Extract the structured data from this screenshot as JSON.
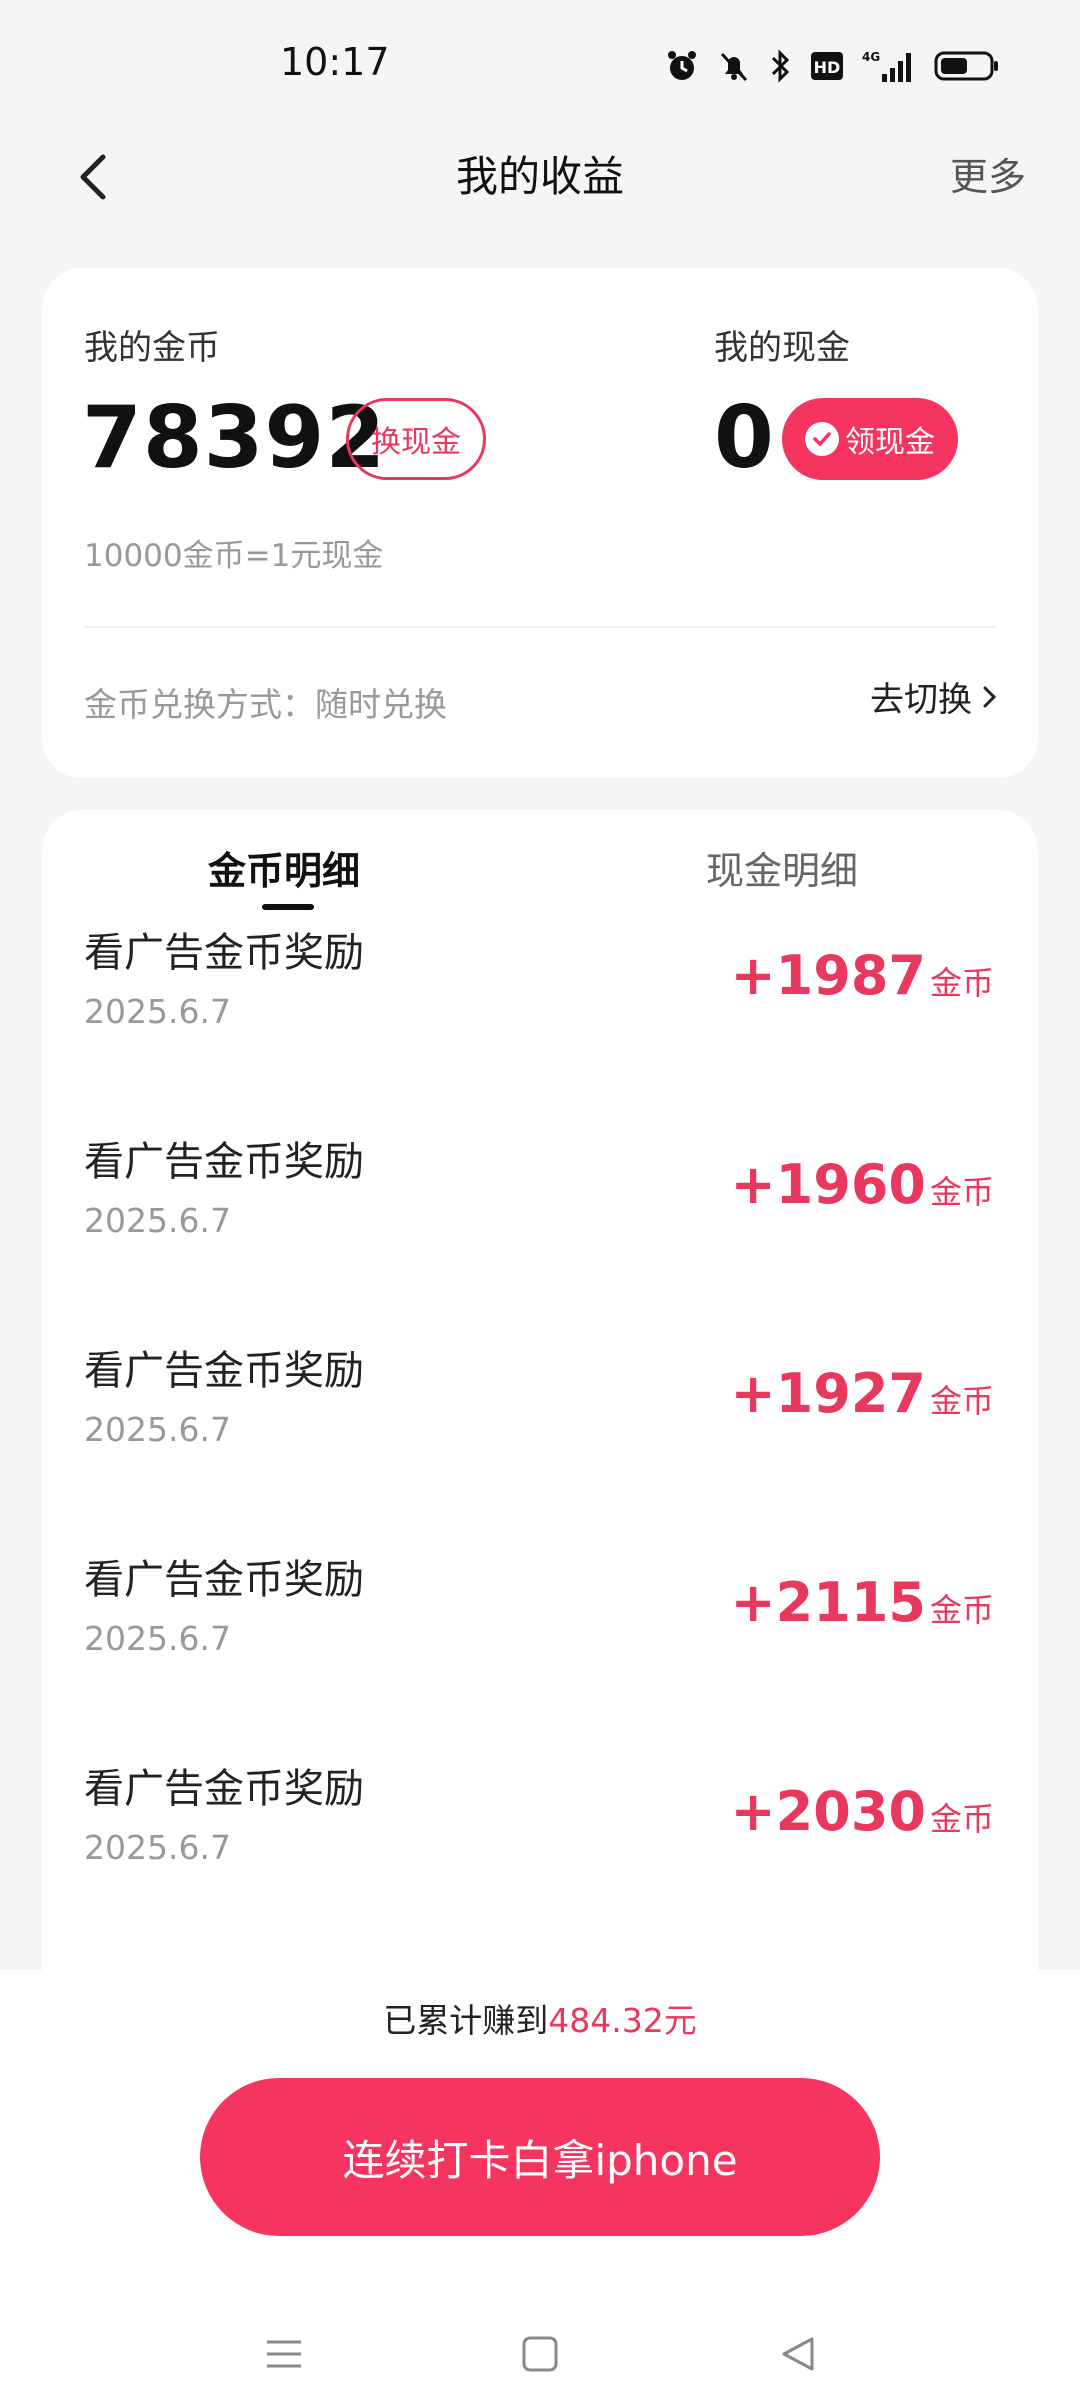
{
  "status": {
    "time": "10:17",
    "network": "4G"
  },
  "header": {
    "title": "我的收益",
    "more": "更多"
  },
  "wallet": {
    "coin_label": "我的金币",
    "coin_value": "78392",
    "exchange_button": "换现金",
    "cash_label": "我的现金",
    "cash_value": "0",
    "claim_button": "领现金",
    "rate": "10000金币=1元现金",
    "exchange_mode": "金币兑换方式：随时兑换",
    "switch_link": "去切换"
  },
  "tabs": [
    {
      "label": "金币明细",
      "active": true
    },
    {
      "label": "现金明细",
      "active": false
    }
  ],
  "records": [
    {
      "title": "看广告金币奖励",
      "date": "2025.6.7",
      "amount": "+1987",
      "unit": "金币"
    },
    {
      "title": "看广告金币奖励",
      "date": "2025.6.7",
      "amount": "+1960",
      "unit": "金币"
    },
    {
      "title": "看广告金币奖励",
      "date": "2025.6.7",
      "amount": "+1927",
      "unit": "金币"
    },
    {
      "title": "看广告金币奖励",
      "date": "2025.6.7",
      "amount": "+2115",
      "unit": "金币"
    },
    {
      "title": "看广告金币奖励",
      "date": "2025.6.7",
      "amount": "+2030",
      "unit": "金币"
    }
  ],
  "footer": {
    "earned_prefix": "已累计赚到",
    "earned_amount": "484.32元",
    "checkin_button": "连续打卡白拿iphone"
  },
  "colors": {
    "accent": "#f5355f",
    "accent_text": "#e8385e"
  }
}
